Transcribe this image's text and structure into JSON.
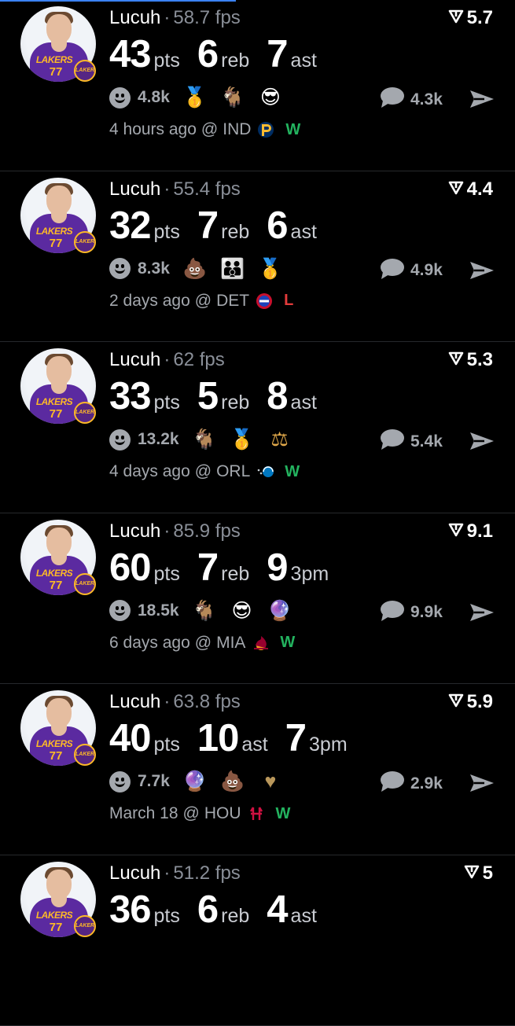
{
  "colors": {
    "background": "#000000",
    "muted": "#a4a8ae",
    "win": "#23b35f",
    "loss": "#e23b3b"
  },
  "posts": [
    {
      "user": "Lucuh",
      "sep": "·",
      "fps": "58.7 fps",
      "rating": "5.7",
      "stats": [
        {
          "value": "43",
          "unit": "pts"
        },
        {
          "value": "6",
          "unit": "reb"
        },
        {
          "value": "7",
          "unit": "ast"
        }
      ],
      "reactions": "4.8k",
      "emojis": [
        {
          "icon": "medal-icon",
          "glyph": "🥇"
        },
        {
          "icon": "goat-icon",
          "glyph": "🐐"
        },
        {
          "icon": "sunglasses-face-icon",
          "glyph": "😎"
        }
      ],
      "comments": "4.3k",
      "time": "4 hours ago",
      "at": "@",
      "opponent": "IND",
      "team_logo": "pacers-logo",
      "result": "W"
    },
    {
      "user": "Lucuh",
      "sep": "·",
      "fps": "55.4 fps",
      "rating": "4.4",
      "stats": [
        {
          "value": "32",
          "unit": "pts"
        },
        {
          "value": "7",
          "unit": "reb"
        },
        {
          "value": "6",
          "unit": "ast"
        }
      ],
      "reactions": "8.3k",
      "emojis": [
        {
          "icon": "poop-icon",
          "glyph": "💩"
        },
        {
          "icon": "family-icon",
          "glyph": "👪"
        },
        {
          "icon": "medal-icon",
          "glyph": "🥇"
        }
      ],
      "comments": "4.9k",
      "time": "2 days ago",
      "at": "@",
      "opponent": "DET",
      "team_logo": "pistons-logo",
      "result": "L"
    },
    {
      "user": "Lucuh",
      "sep": "·",
      "fps": "62 fps",
      "rating": "5.3",
      "stats": [
        {
          "value": "33",
          "unit": "pts"
        },
        {
          "value": "5",
          "unit": "reb"
        },
        {
          "value": "8",
          "unit": "ast"
        }
      ],
      "reactions": "13.2k",
      "emojis": [
        {
          "icon": "goat-icon",
          "glyph": "🐐"
        },
        {
          "icon": "medal-icon",
          "glyph": "🥇"
        },
        {
          "icon": "scales-icon",
          "glyph": "⚖"
        }
      ],
      "comments": "5.4k",
      "time": "4 days ago",
      "at": "@",
      "opponent": "ORL",
      "team_logo": "magic-logo",
      "result": "W"
    },
    {
      "user": "Lucuh",
      "sep": "·",
      "fps": "85.9 fps",
      "rating": "9.1",
      "stats": [
        {
          "value": "60",
          "unit": "pts"
        },
        {
          "value": "7",
          "unit": "reb"
        },
        {
          "value": "9",
          "unit": "3pm"
        }
      ],
      "reactions": "18.5k",
      "emojis": [
        {
          "icon": "goat-icon",
          "glyph": "🐐"
        },
        {
          "icon": "sunglasses-face-icon",
          "glyph": "😎"
        },
        {
          "icon": "crystal-ball-icon",
          "glyph": "🔮"
        }
      ],
      "comments": "9.9k",
      "time": "6 days ago",
      "at": "@",
      "opponent": "MIA",
      "team_logo": "heat-logo",
      "result": "W"
    },
    {
      "user": "Lucuh",
      "sep": "·",
      "fps": "63.8 fps",
      "rating": "5.9",
      "stats": [
        {
          "value": "40",
          "unit": "pts"
        },
        {
          "value": "10",
          "unit": "ast"
        },
        {
          "value": "7",
          "unit": "3pm"
        }
      ],
      "reactions": "7.7k",
      "emojis": [
        {
          "icon": "crystal-ball-icon",
          "glyph": "🔮"
        },
        {
          "icon": "poop-icon",
          "glyph": "💩"
        },
        {
          "icon": "gold-heart-icon",
          "glyph": "♥"
        }
      ],
      "comments": "2.9k",
      "time": "March 18",
      "at": "@",
      "opponent": "HOU",
      "team_logo": "rockets-logo",
      "result": "W"
    },
    {
      "user": "Lucuh",
      "sep": "·",
      "fps": "51.2 fps",
      "rating": "5",
      "stats": [
        {
          "value": "36",
          "unit": "pts"
        },
        {
          "value": "6",
          "unit": "reb"
        },
        {
          "value": "4",
          "unit": "ast"
        }
      ],
      "reactions": "",
      "emojis": [],
      "comments": "",
      "time": "",
      "at": "",
      "opponent": "",
      "team_logo": "",
      "result": ""
    }
  ]
}
